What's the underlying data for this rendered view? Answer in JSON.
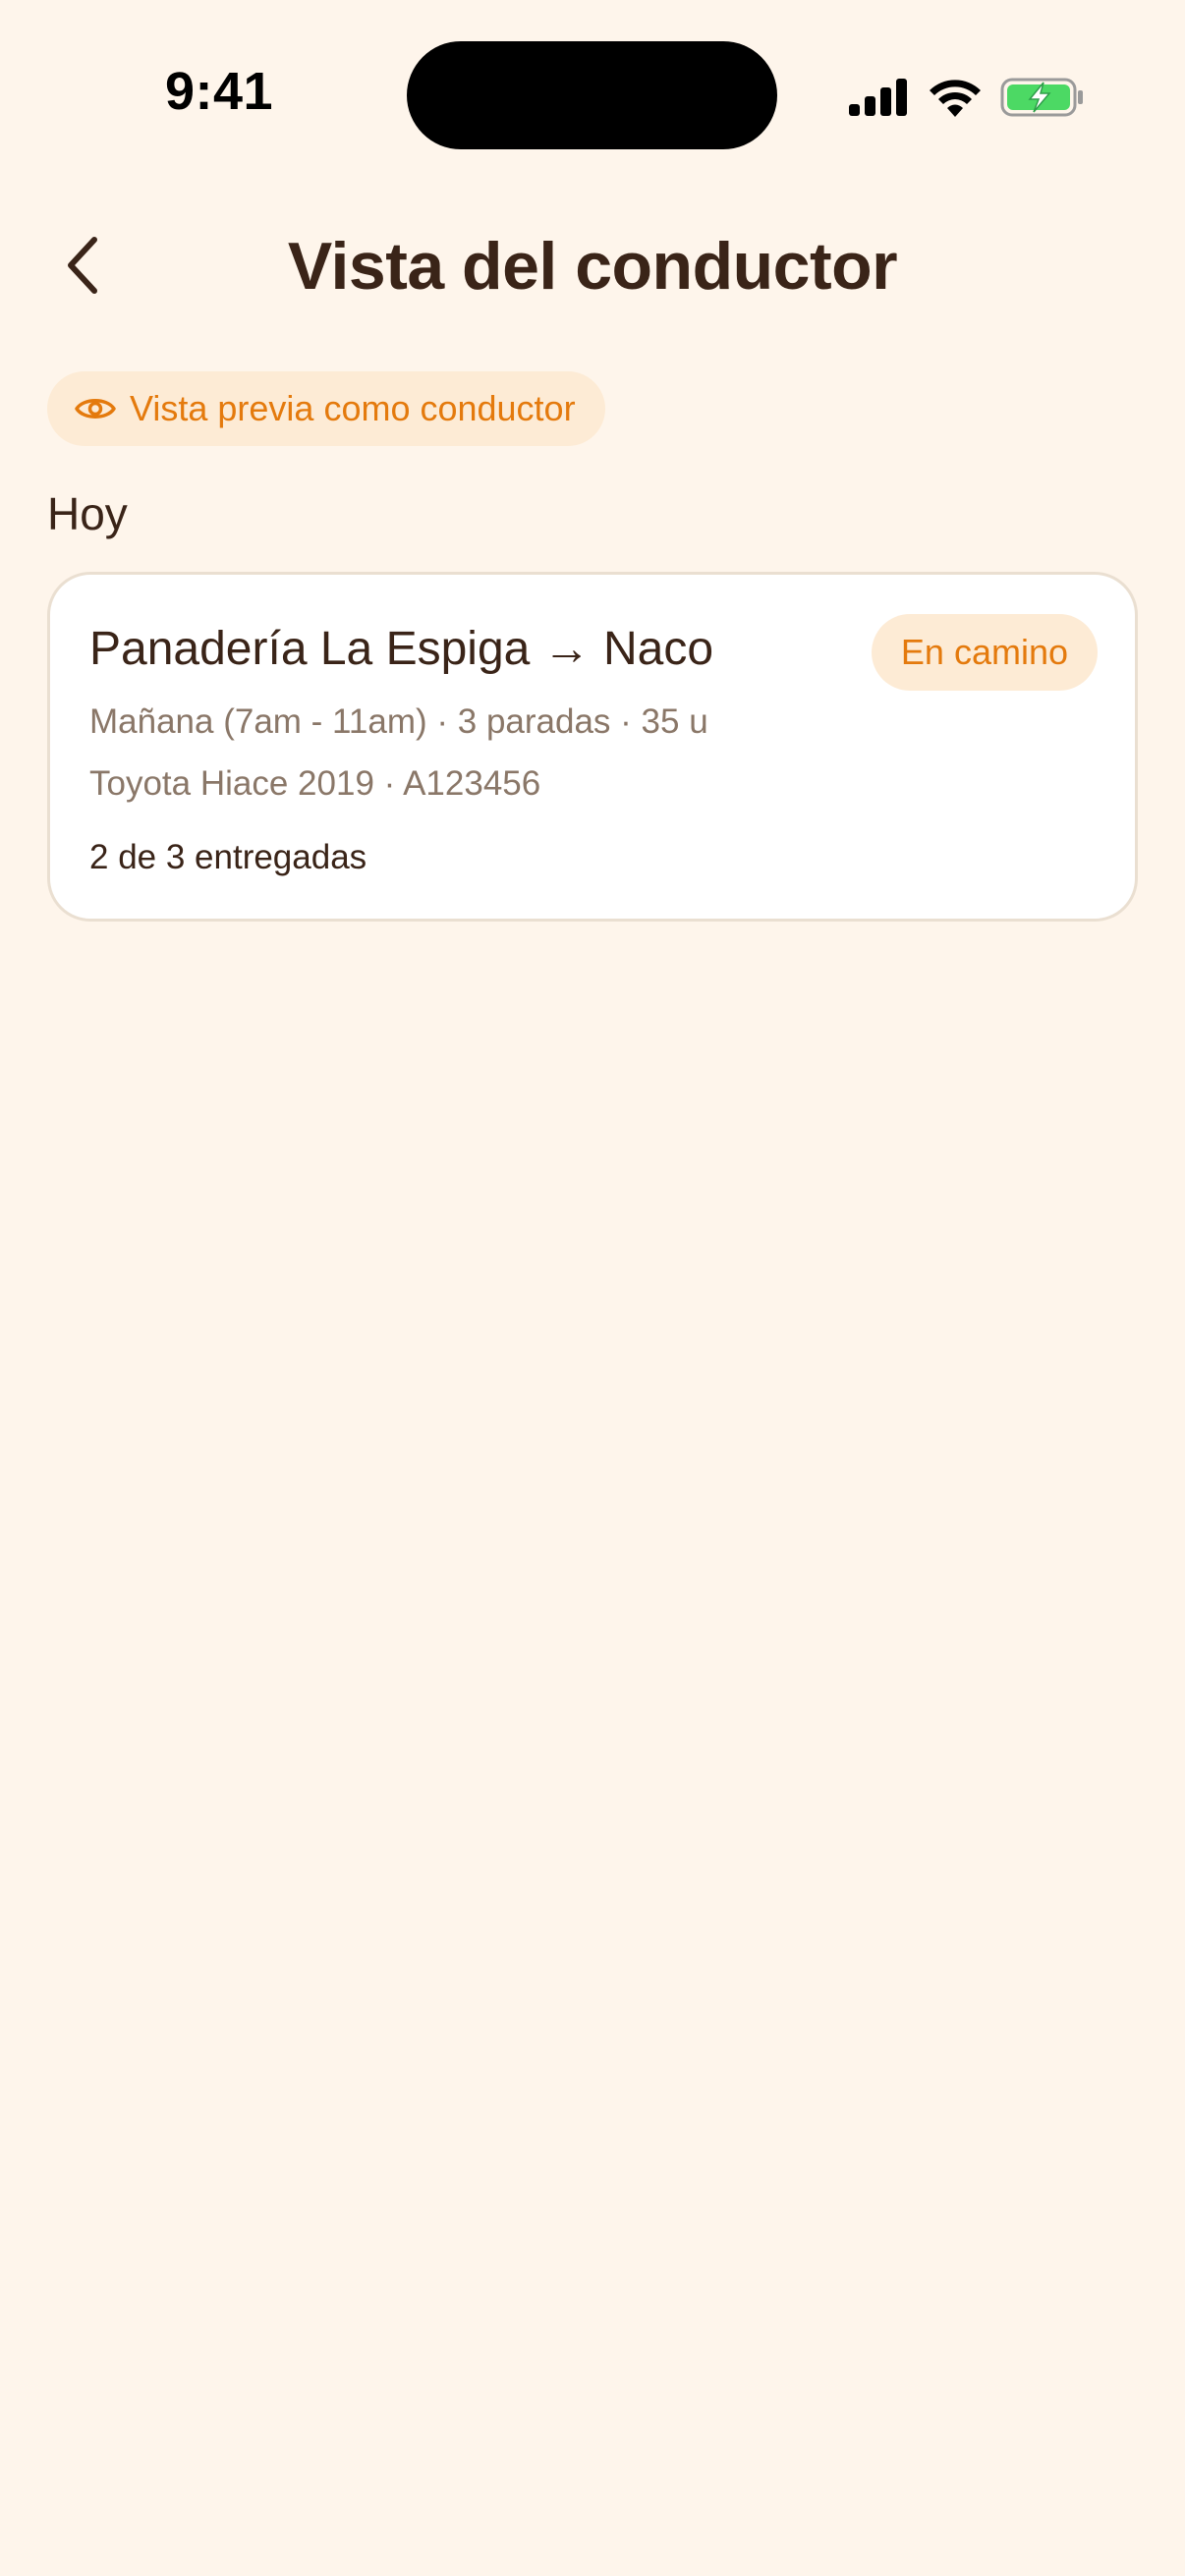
{
  "status_bar": {
    "time": "9:41",
    "icons": [
      "cellular-signal-icon",
      "wifi-icon",
      "battery-charging-icon"
    ]
  },
  "header": {
    "back_icon": "chevron-left-icon",
    "title": "Vista del conductor"
  },
  "preview_chip": {
    "icon": "eye-icon",
    "label": "Vista previa como conductor"
  },
  "section": {
    "heading": "Hoy"
  },
  "route_card": {
    "title": "Panadería La Espiga → Naco",
    "status": "En camino",
    "meta": "Mañana (7am - 11am) · 3 paradas · 35 u",
    "vehicle": "Toyota Hiace 2019 · A123456",
    "progress": "2 de 3 entregadas"
  },
  "colors": {
    "background": "#FEF5EB",
    "text_primary": "#3A2418",
    "text_secondary": "#8A7768",
    "accent": "#E47A0D",
    "accent_soft": "#FDEBD5",
    "battery_fill": "#4CD964"
  }
}
